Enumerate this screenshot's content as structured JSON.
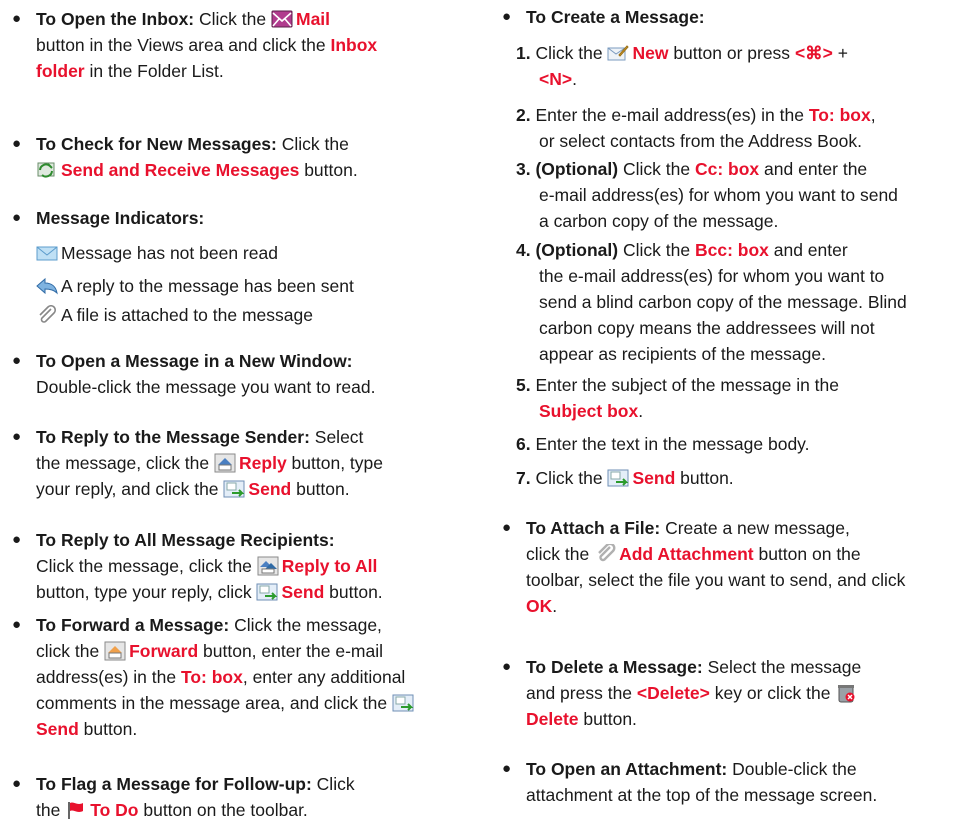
{
  "left": {
    "open_inbox": {
      "heading": "To Open the Inbox:",
      "t1": "Click the",
      "mail": "Mail",
      "t2": "button in the Views area and click the",
      "inbox1": "Inbox",
      "inbox2": "folder",
      "t3": "in the Folder List."
    },
    "check_new": {
      "heading": "To Check for New Messages:",
      "t1": "Click the",
      "btn": "Send and Receive Messages",
      "t2": "button."
    },
    "indicators": {
      "heading": "Message Indicators:",
      "unread": "Message has not been read",
      "replied": "A reply to the message has been sent",
      "attached": "A file is attached to the message"
    },
    "new_window": {
      "heading": "To Open a Message in a New Window:",
      "body": "Double-click the message you want to read."
    },
    "reply_sender": {
      "heading": "To Reply to the Message Sender:",
      "t1": "Select",
      "t2": "the message, click the",
      "reply": "Reply",
      "t3": "button, type",
      "t4": "your reply, and click the",
      "send": "Send",
      "t5": "button."
    },
    "reply_all": {
      "heading": "To Reply to All Message Recipients:",
      "t1": "Click the message, click the",
      "reply_all": "Reply to All",
      "t2": "button, type your reply, click",
      "send": "Send",
      "t3": "button."
    },
    "forward": {
      "heading": "To Forward a Message:",
      "t1": "Click the message,",
      "t2": "click the",
      "fwd": "Forward",
      "t3": "button, enter the e-mail",
      "t4": "address(es) in the",
      "to": "To: box",
      "t5": ", enter any additional",
      "t6": "comments in the message area, and click the",
      "send": "Send",
      "t7": "button."
    },
    "flag": {
      "heading": "To Flag a Message for Follow-up:",
      "t1": "Click",
      "t2": "the",
      "todo": "To Do",
      "t3": "button on the toolbar."
    }
  },
  "right": {
    "create": {
      "heading": "To Create a Message:",
      "s1": {
        "n": "1.",
        "t1": "Click the",
        "new": "New",
        "t2": "button or press",
        "key1": "<⌘>",
        "plus": "+",
        "key2": "<N>",
        "dot": "."
      },
      "s2": {
        "n": "2.",
        "t1": "Enter the e-mail address(es) in the",
        "to": "To: box",
        "t2": ",",
        "t3": "or select contacts from the Address Book."
      },
      "s3": {
        "n": "3.",
        "opt": "(Optional)",
        "t1": "Click the",
        "cc": "Cc: box",
        "t2": "and enter the",
        "t3": "e-mail address(es) for whom you want to send",
        "t4": "a carbon copy of the message."
      },
      "s4": {
        "n": "4.",
        "opt": "(Optional)",
        "t1": "Click the",
        "bcc": "Bcc: box",
        "t2": "and enter",
        "t3": "the e-mail address(es) for whom you want to",
        "t4": "send a blind carbon copy of the message. Blind",
        "t5": "carbon copy means the addressees will not",
        "t6": "appear as recipients of the message."
      },
      "s5": {
        "n": "5.",
        "t1": "Enter the subject of the message in the",
        "subj": "Subject box",
        "dot": "."
      },
      "s6": {
        "n": "6.",
        "t1": "Enter the text in the message body."
      },
      "s7": {
        "n": "7.",
        "t1": "Click the",
        "send": "Send",
        "t2": "button."
      }
    },
    "attach": {
      "heading": "To Attach a File:",
      "t1": "Create a new message,",
      "t2": "click the",
      "add": "Add Attachment",
      "t3": "button on the",
      "t4": "toolbar, select the file you want to send, and click",
      "ok": "OK",
      "dot": "."
    },
    "delete": {
      "heading": "To Delete a Message:",
      "t1": "Select the message",
      "t2": "and press the",
      "key": "<Delete>",
      "t3": "key or click the",
      "del": "Delete",
      "t4": "button."
    },
    "open_attach": {
      "heading": "To Open an Attachment:",
      "t1": "Double-click the",
      "t2": "attachment at the top of the message screen."
    }
  },
  "colors": {
    "accent": "#e8112d",
    "text": "#1a1a1a"
  },
  "icons": [
    "mail-icon",
    "send-receive-icon",
    "envelope-unread-icon",
    "reply-arrow-icon",
    "paperclip-icon",
    "reply-icon",
    "send-icon",
    "reply-all-icon",
    "forward-icon",
    "flag-icon",
    "new-message-icon",
    "add-attachment-icon",
    "delete-trash-icon"
  ]
}
